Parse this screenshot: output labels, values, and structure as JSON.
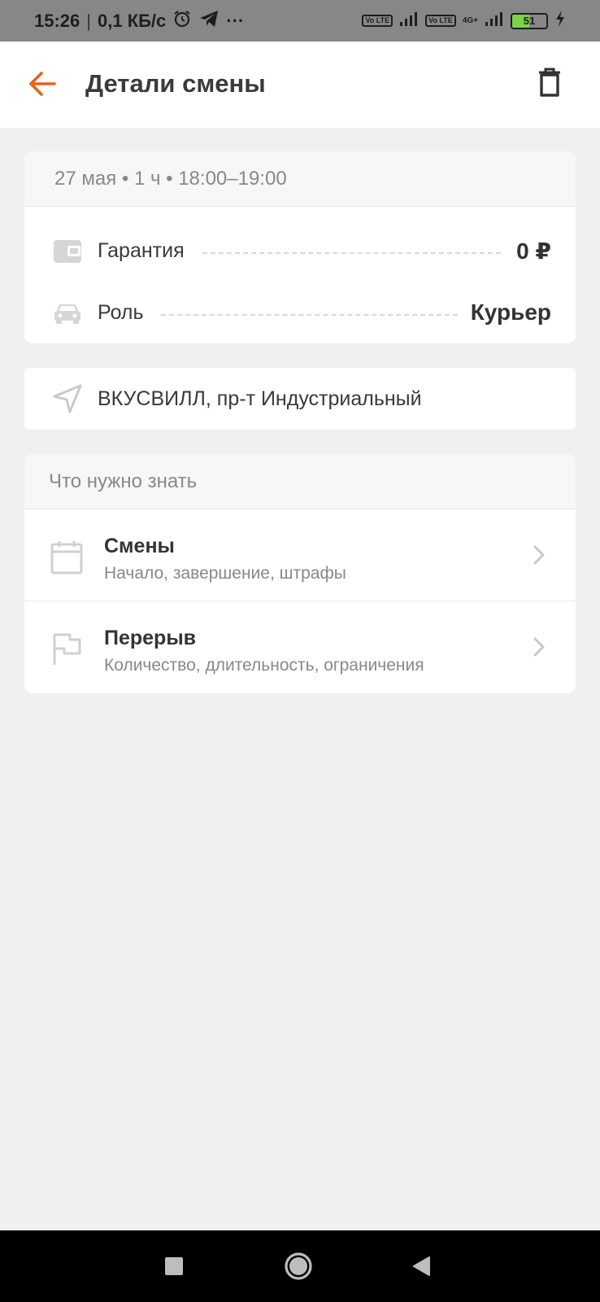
{
  "status_bar": {
    "time": "15:26",
    "separator": "|",
    "net_speed": "0,1 КБ/с",
    "more": "···",
    "volte_1": "Vo LTE",
    "volte_2": "Vo LTE",
    "network_type": "4G+",
    "battery_level": "51",
    "battery_fraction": 0.51,
    "icons": [
      "alarm-icon",
      "telegram-icon",
      "signal-icon",
      "charging-icon"
    ]
  },
  "header": {
    "title": "Детали смены",
    "back_icon": "arrow-left-icon",
    "delete_icon": "trash-icon",
    "accent_color": "#e8601c"
  },
  "shift": {
    "summary": "27 мая • 1 ч • 18:00–19:00",
    "guarantee_label": "Гарантия",
    "guarantee_value": "0 ₽",
    "role_label": "Роль",
    "role_value": "Курьер"
  },
  "location": {
    "address": "ВКУСВИЛЛ, пр-т Индустриальный"
  },
  "info": {
    "header": "Что нужно знать",
    "items": [
      {
        "title": "Смены",
        "subtitle": "Начало, завершение, штрафы",
        "icon": "calendar-icon"
      },
      {
        "title": "Перерыв",
        "subtitle": "Количество, длительность, ограничения",
        "icon": "flag-icon"
      }
    ]
  },
  "nav": {
    "icons": [
      "recents-square-icon",
      "home-circle-icon",
      "back-triangle-icon"
    ]
  }
}
